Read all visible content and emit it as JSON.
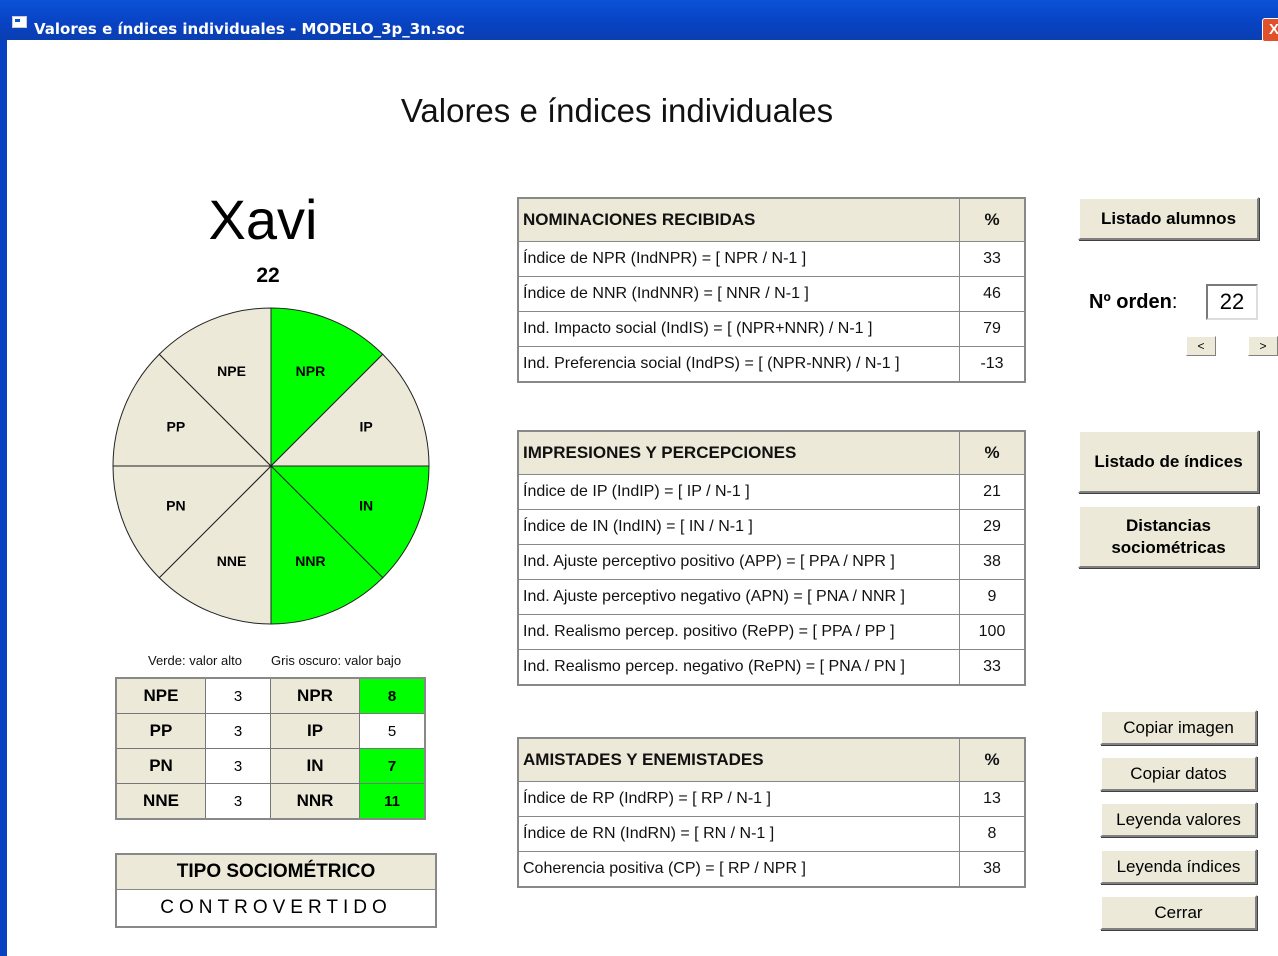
{
  "window": {
    "title": "Valores e índices individuales - MODELO_3p_3n.soc",
    "close": "X"
  },
  "page_title": "Valores e índices individuales",
  "student": {
    "name": "Xavi",
    "number": "22"
  },
  "pie": {
    "sectors": [
      {
        "label": "NPR",
        "level": "high",
        "color": "#00ff00"
      },
      {
        "label": "IP",
        "level": "normal",
        "color": "#ece9d8"
      },
      {
        "label": "IN",
        "level": "high",
        "color": "#00ff00"
      },
      {
        "label": "NNR",
        "level": "high",
        "color": "#00ff00"
      },
      {
        "label": "NNE",
        "level": "normal",
        "color": "#ece9d8"
      },
      {
        "label": "PN",
        "level": "normal",
        "color": "#ece9d8"
      },
      {
        "label": "PP",
        "level": "normal",
        "color": "#ece9d8"
      },
      {
        "label": "NPE",
        "level": "normal",
        "color": "#ece9d8"
      }
    ]
  },
  "legend": {
    "green": "Verde: valor alto",
    "gray": "Gris oscuro: valor bajo"
  },
  "values_table": [
    {
      "l1": "NPE",
      "v1": "3",
      "l2": "NPR",
      "v2": "8",
      "v2_high": true
    },
    {
      "l1": "PP",
      "v1": "3",
      "l2": "IP",
      "v2": "5",
      "v2_high": false
    },
    {
      "l1": "PN",
      "v1": "3",
      "l2": "IN",
      "v2": "7",
      "v2_high": true
    },
    {
      "l1": "NNE",
      "v1": "3",
      "l2": "NNR",
      "v2": "11",
      "v2_high": true
    }
  ],
  "tipo": {
    "header": "TIPO SOCIOMÉTRICO",
    "value": "CONTROVERTIDO"
  },
  "tables": [
    {
      "header": "NOMINACIONES RECIBIDAS",
      "pct": "%",
      "rows": [
        {
          "name": "Índice de NPR (IndNPR) = [ NPR / N-1 ]",
          "value": "33"
        },
        {
          "name": "Índice de NNR (IndNNR) = [ NNR / N-1 ]",
          "value": "46"
        },
        {
          "name": "Ind. Impacto social (IndIS) = [ (NPR+NNR) / N-1 ]",
          "value": "79"
        },
        {
          "name": "Ind. Preferencia social (IndPS) = [ (NPR-NNR) / N-1 ]",
          "value": "-13"
        }
      ]
    },
    {
      "header": "IMPRESIONES Y PERCEPCIONES",
      "pct": "%",
      "rows": [
        {
          "name": "Índice de IP (IndIP) = [ IP / N-1 ]",
          "value": "21"
        },
        {
          "name": "Índice de IN (IndIN) = [ IN / N-1 ]",
          "value": "29"
        },
        {
          "name": "Ind. Ajuste perceptivo positivo (APP) = [ PPA / NPR ]",
          "value": "38"
        },
        {
          "name": "Ind. Ajuste perceptivo negativo (APN) = [ PNA / NNR ]",
          "value": "9"
        },
        {
          "name": "Ind. Realismo percep. positivo (RePP) = [ PPA / PP ]",
          "value": "100"
        },
        {
          "name": "Ind. Realismo percep. negativo (RePN) = [ PNA / PN ]",
          "value": "33"
        }
      ]
    },
    {
      "header": "AMISTADES Y ENEMISTADES",
      "pct": "%",
      "rows": [
        {
          "name": "Índice de RP (IndRP) = [ RP / N-1 ]",
          "value": "13"
        },
        {
          "name": "Índice de RN (IndRN) = [ RN / N-1 ]",
          "value": "8"
        },
        {
          "name": "Coherencia positiva (CP) = [ RP / NPR ]",
          "value": "38"
        }
      ]
    }
  ],
  "buttons": {
    "listado_alumnos": "Listado alumnos",
    "orden_label": "Nº orden",
    "orden_colon": ":",
    "orden_value": "22",
    "prev": "<",
    "next": ">",
    "listado_indices": "Listado de índices",
    "distancias": "Distancias sociométricas",
    "copiar_imagen": "Copiar imagen",
    "copiar_datos": "Copiar datos",
    "leyenda_valores": "Leyenda valores",
    "leyenda_indices": "Leyenda índices",
    "cerrar": "Cerrar"
  }
}
